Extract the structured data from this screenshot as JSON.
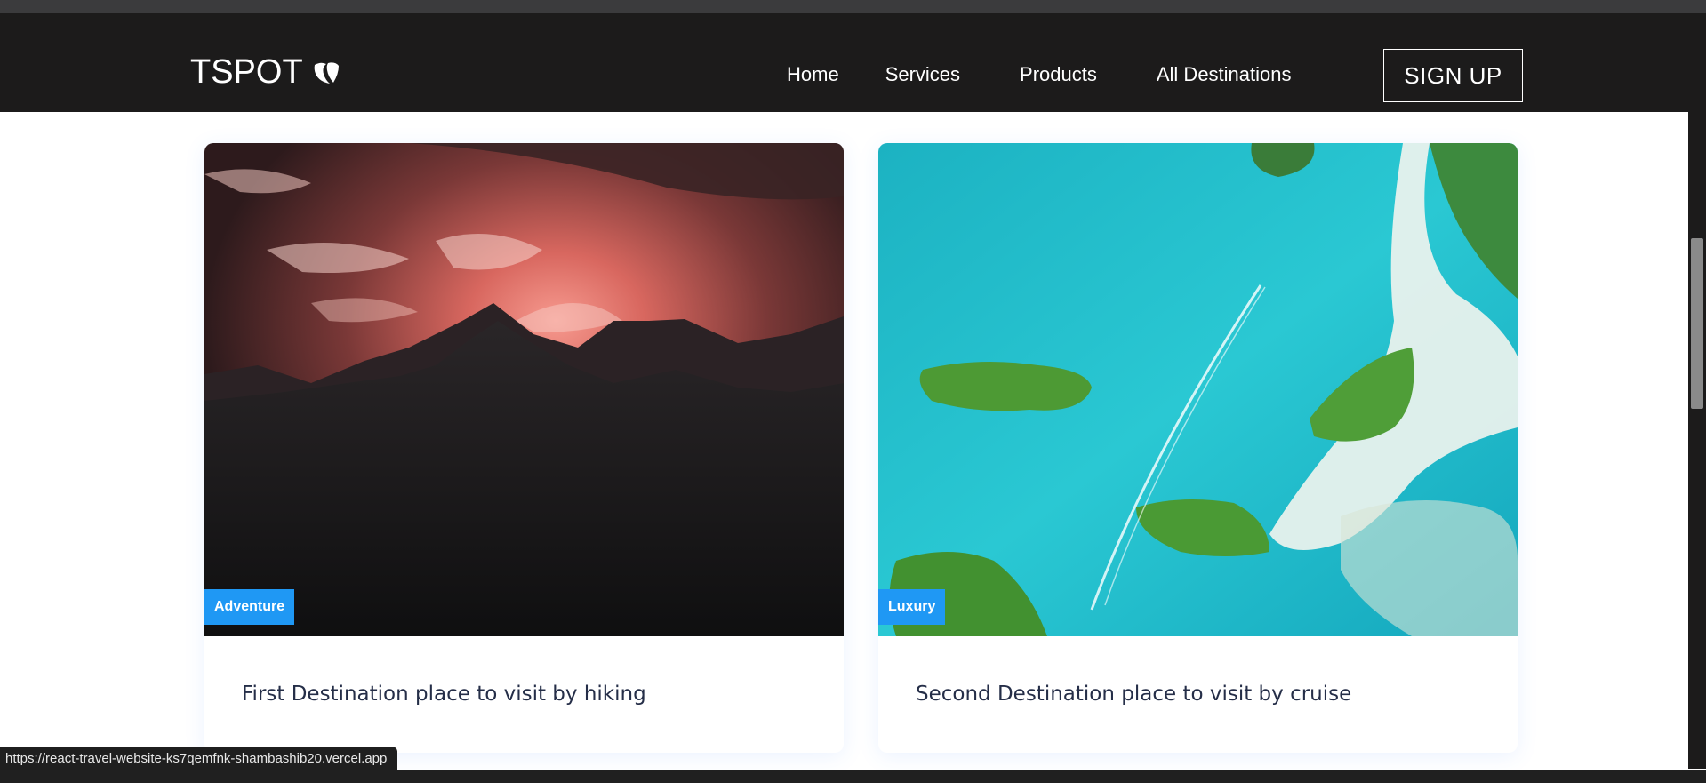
{
  "header": {
    "logo_text": "TSPOT",
    "nav_items": [
      {
        "label": "Home"
      },
      {
        "label": "Services"
      },
      {
        "label": "Products"
      },
      {
        "label": "All Destinations"
      }
    ],
    "signup_label": "SIGN UP"
  },
  "cards": [
    {
      "badge": "Adventure",
      "title": "First Destination place to visit by hiking",
      "image": "mountain-sunset"
    },
    {
      "badge": "Luxury",
      "title": "Second Destination place to visit by cruise",
      "image": "tropical-islands-aerial"
    }
  ],
  "status_bar": {
    "url": "https://react-travel-website-ks7qemfnk-shambashib20.vercel.app"
  },
  "colors": {
    "navbar_bg": "#1c1b1b",
    "badge_bg": "#1f98f4",
    "title_text": "#252e48"
  }
}
